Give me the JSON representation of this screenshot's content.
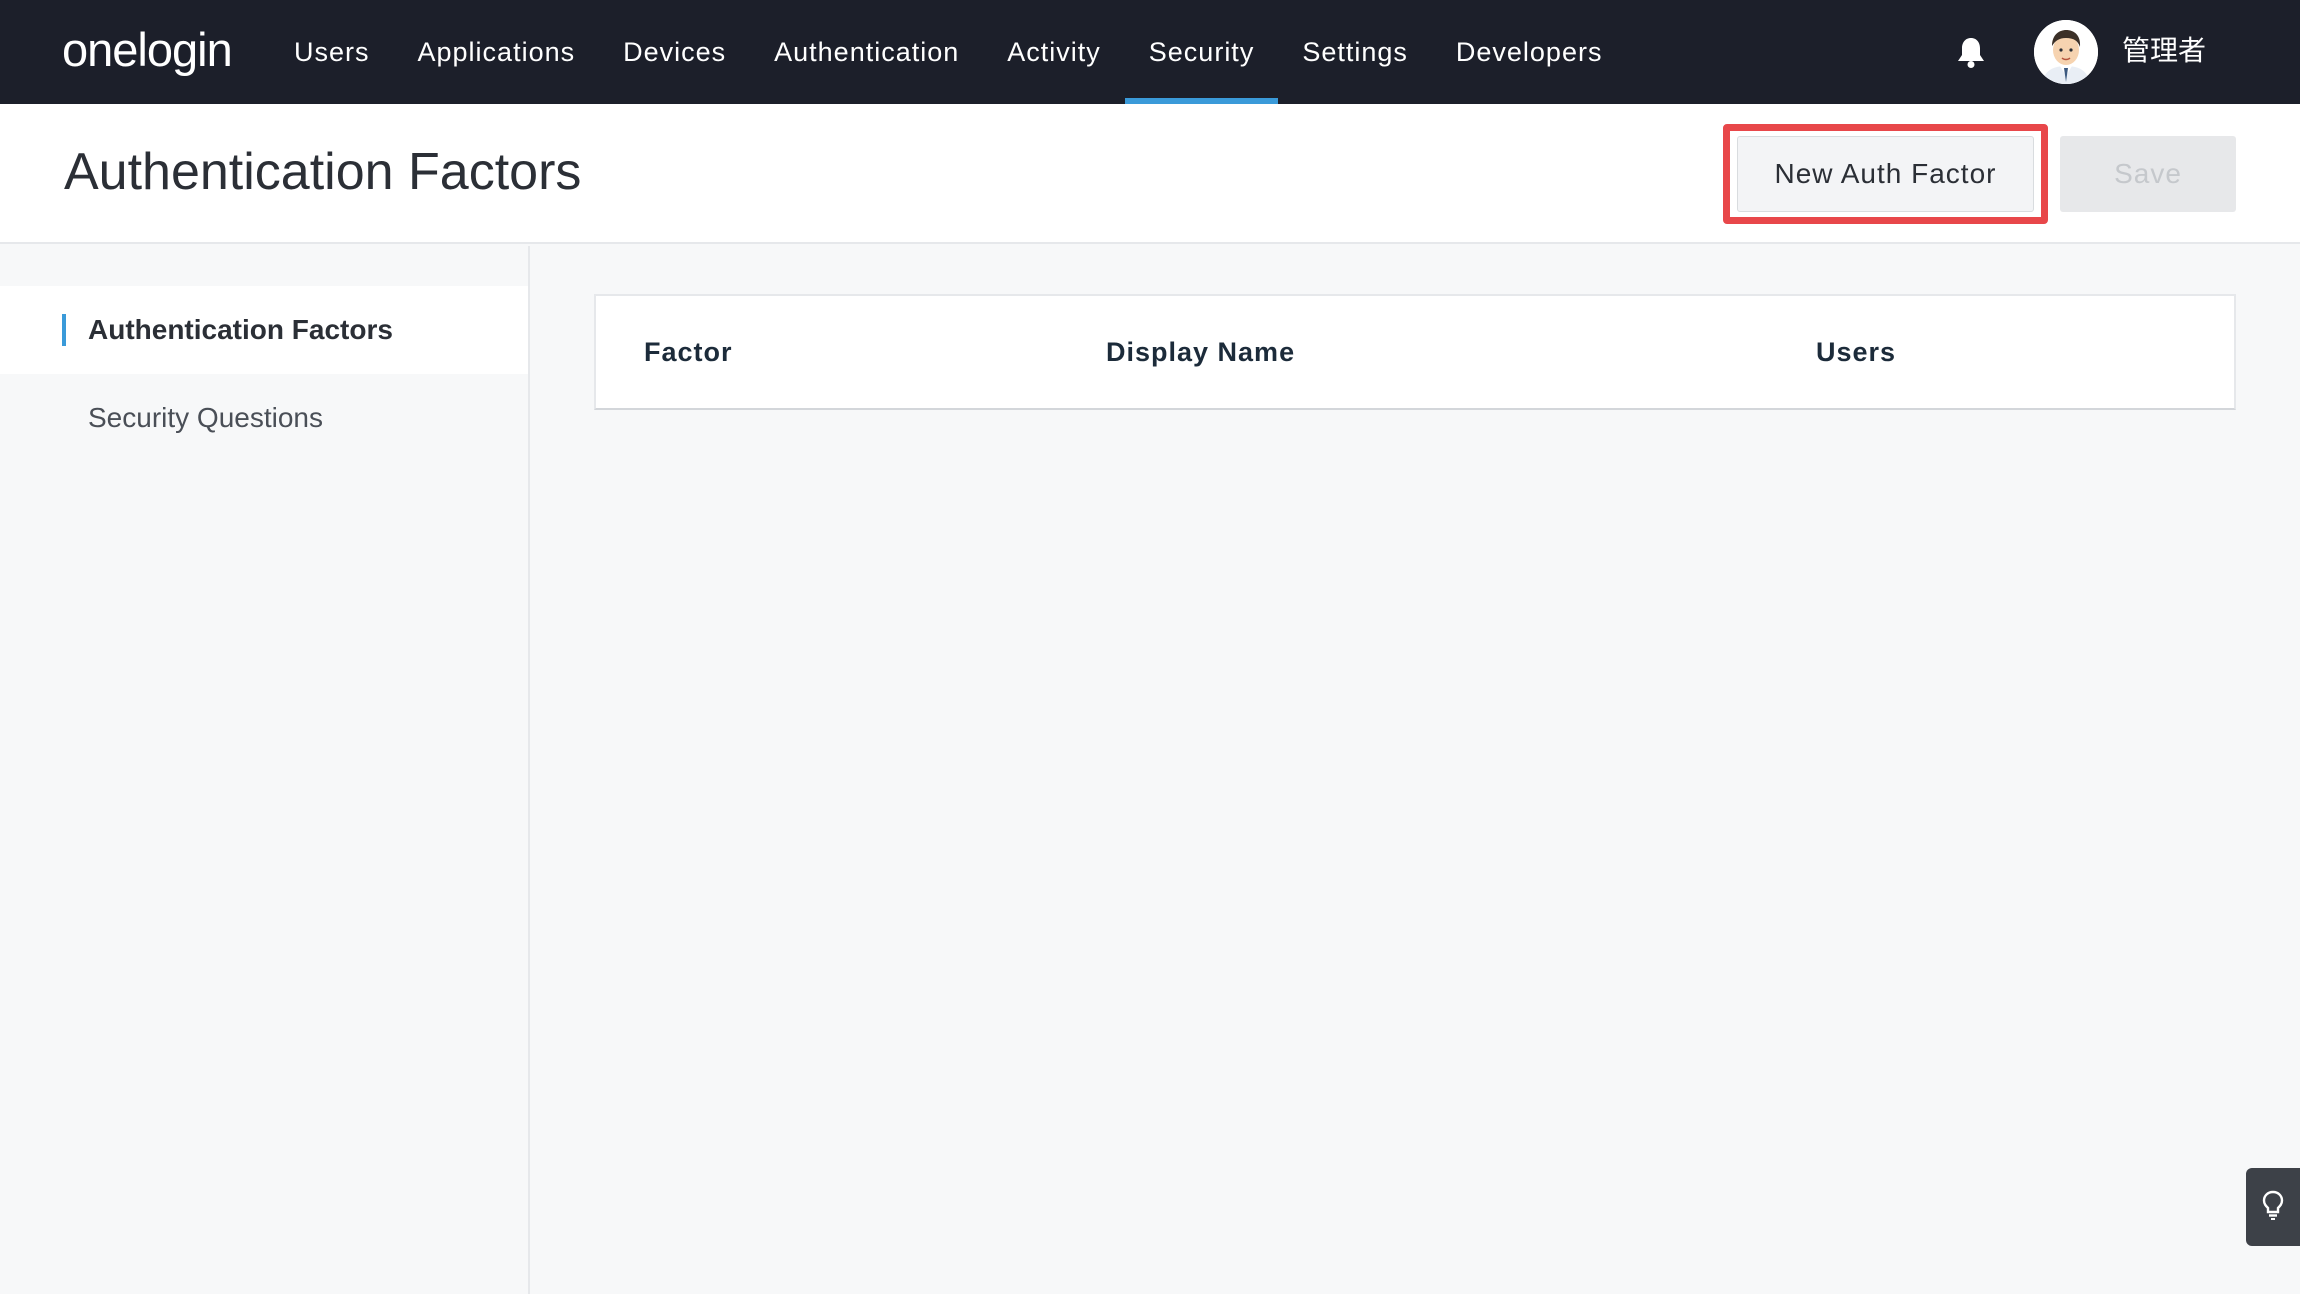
{
  "app": {
    "logo_text": "onelogin"
  },
  "nav": {
    "items": [
      {
        "label": "Users"
      },
      {
        "label": "Applications"
      },
      {
        "label": "Devices"
      },
      {
        "label": "Authentication"
      },
      {
        "label": "Activity"
      },
      {
        "label": "Security",
        "active": true
      },
      {
        "label": "Settings"
      },
      {
        "label": "Developers"
      }
    ]
  },
  "user": {
    "name": "管理者"
  },
  "header": {
    "title": "Authentication Factors",
    "new_button_label": "New Auth Factor",
    "save_button_label": "Save"
  },
  "sidebar": {
    "items": [
      {
        "label": "Authentication Factors",
        "active": true
      },
      {
        "label": "Security Questions"
      }
    ]
  },
  "table": {
    "columns": [
      "Factor",
      "Display Name",
      "Users"
    ],
    "rows": []
  },
  "colors": {
    "topbar": "#1c1f2a",
    "accent": "#3a9ad9",
    "highlight": "#e8474a"
  },
  "icons": {
    "bell": "bell-icon",
    "avatar": "avatar",
    "help": "lightbulb-icon"
  }
}
